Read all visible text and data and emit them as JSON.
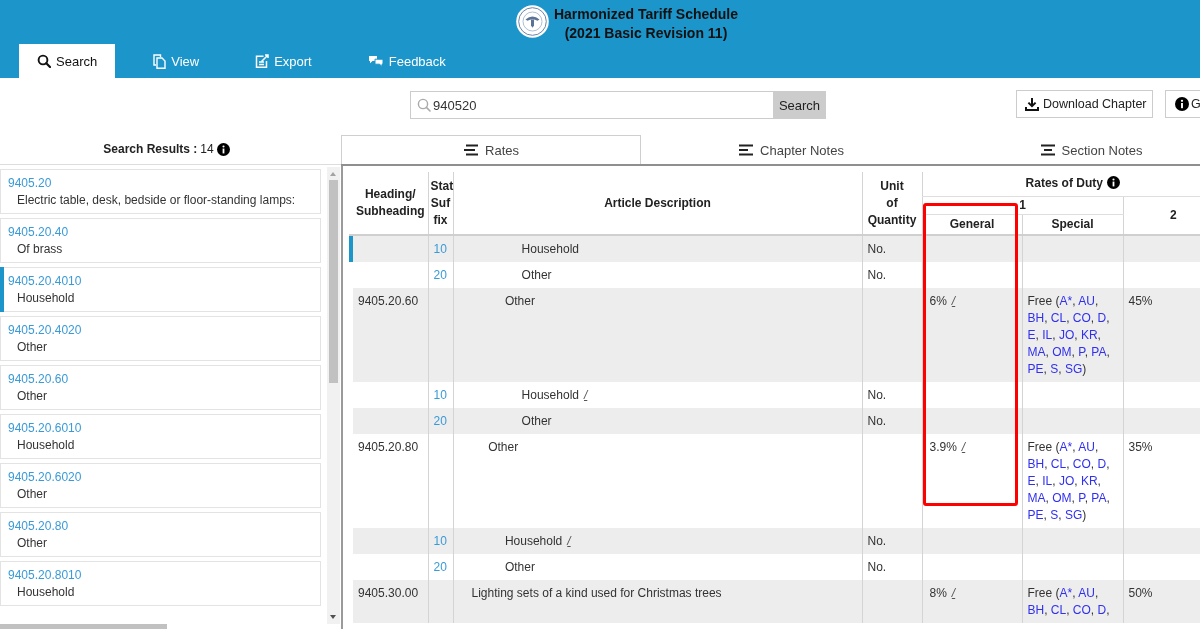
{
  "header": {
    "title": "Harmonized Tariff Schedule",
    "subtitle": "(2021 Basic Revision 11)",
    "tabs": [
      {
        "label": "Search",
        "selected": true
      },
      {
        "label": "View",
        "selected": false
      },
      {
        "label": "Export",
        "selected": false
      },
      {
        "label": "Feedback",
        "selected": false
      }
    ]
  },
  "toolbar": {
    "search_value": "940520",
    "search_button": "Search",
    "buttons": [
      "Download Chapter",
      "G"
    ]
  },
  "results": {
    "title": "Search Results :",
    "count": "14",
    "items": [
      {
        "code": "9405.20",
        "description": "Electric table, desk, bedside or floor-standing lamps:",
        "selected": false
      },
      {
        "code": "9405.20.40",
        "description": "Of brass",
        "selected": false
      },
      {
        "code": "9405.20.4010",
        "description": "Household",
        "selected": true
      },
      {
        "code": "9405.20.4020",
        "description": "Other",
        "selected": false
      },
      {
        "code": "9405.20.60",
        "description": "Other",
        "selected": false
      },
      {
        "code": "9405.20.6010",
        "description": "Household",
        "selected": false
      },
      {
        "code": "9405.20.6020",
        "description": "Other",
        "selected": false
      },
      {
        "code": "9405.20.80",
        "description": "Other",
        "selected": false
      },
      {
        "code": "9405.20.8010",
        "description": "Household",
        "selected": false
      }
    ]
  },
  "panel_tabs": [
    {
      "label": "Rates",
      "selected": true
    },
    {
      "label": "Chapter Notes",
      "selected": false
    },
    {
      "label": "Section Notes",
      "selected": false
    }
  ],
  "table": {
    "columns": {
      "heading": "Heading/ Subheading",
      "stat": "Stat Suf fix",
      "description": "Article Description",
      "unit": "Unit of Quantity",
      "rates": "Rates of Duty",
      "column_1": "1",
      "general": "General",
      "special": "Special",
      "column_2": "2"
    },
    "general_highlighted": true,
    "rows": [
      [
        [
          [
            {
              "stat": "10",
              "description": "Household",
              "unit": "No.",
              "selected": true
            },
            {
              "stat": "20",
              "description": "Other",
              "unit": "No.",
              "selected": false
            }
          ],
          {
            "heading": "9405.20.60",
            "description": "Other",
            "general": "6%",
            "general_note": "/",
            "special": {
              "lead": "Free (",
              "programs": [
                "A*",
                "AU",
                "BH",
                "CL",
                "CO",
                "D",
                "E",
                "IL",
                "JO",
                "KR",
                "MA",
                "OM",
                "P",
                "PA",
                "PE",
                "S",
                "SG"
              ],
              "separator": ", ",
              "trail": ")"
            },
            "column_2": "45%",
            "selected": false,
            "children": [
              {
                "stat": "10",
                "description": "Household",
                "description_note": "/",
                "unit": "No.",
                "selected": false
              },
              {
                "stat": "20",
                "description": "Other",
                "unit": "No.",
                "selected": false
              }
            ]
          }
        ],
        {
          "heading": "9405.20.80",
          "description": "Other",
          "general": "3.9%",
          "general_note": "/",
          "special": {
            "lead": "Free (",
            "programs": [
              "A*",
              "AU",
              "BH",
              "CL",
              "CO",
              "D",
              "E",
              "IL",
              "JO",
              "KR",
              "MA",
              "OM",
              "P",
              "PA",
              "PE",
              "S",
              "SG"
            ],
            "separator": ", ",
            "trail": ")"
          },
          "column_2": "35%",
          "selected": false,
          "children": [
            {
              "stat": "10",
              "description": "Household",
              "description_note": "/",
              "unit": "No.",
              "selected": false
            },
            {
              "stat": "20",
              "description": "Other",
              "unit": "No.",
              "selected": false
            }
          ]
        }
      ],
      {
        "heading": "9405.30.00",
        "description": "Lighting sets of a kind used for Christmas trees",
        "general": "8%",
        "general_note": "/",
        "special": {
          "lead": "Free (",
          "programs": [
            "A*",
            "AU",
            "BH",
            "CL",
            "CO",
            "D"
          ],
          "separator": ", ",
          "trail": ","
        },
        "column_2": "50%",
        "selected": false
      }
    ]
  }
}
